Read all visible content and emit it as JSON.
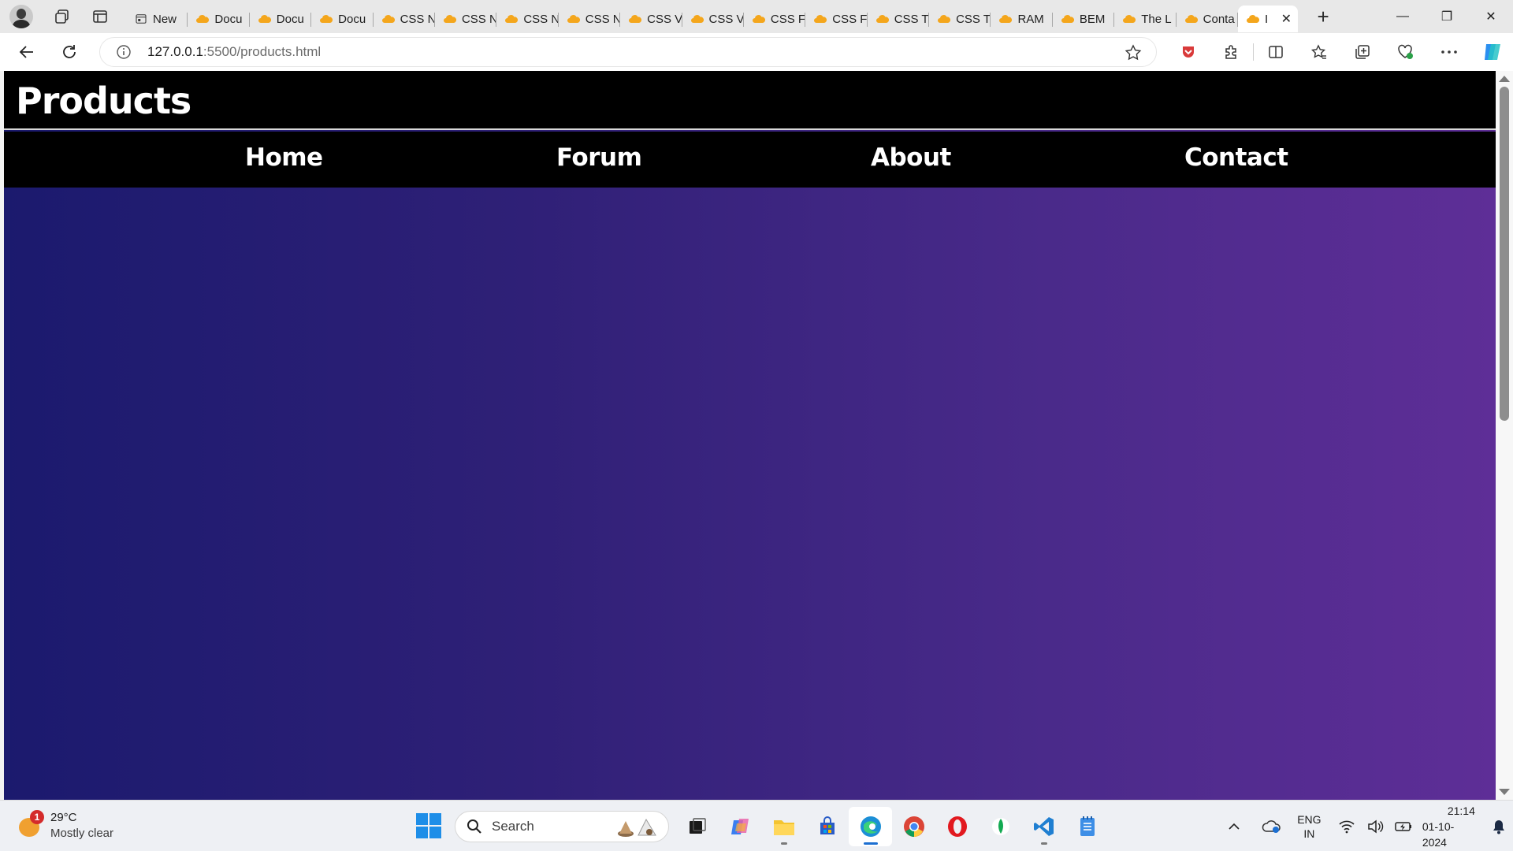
{
  "browser": {
    "tabs": [
      {
        "label": "New",
        "kind": "newtab"
      },
      {
        "label": "Docu",
        "kind": "cloud"
      },
      {
        "label": "Docu",
        "kind": "cloud"
      },
      {
        "label": "Docu",
        "kind": "cloud"
      },
      {
        "label": "CSS N",
        "kind": "cloud"
      },
      {
        "label": "CSS N",
        "kind": "cloud"
      },
      {
        "label": "CSS N",
        "kind": "cloud"
      },
      {
        "label": "CSS N",
        "kind": "cloud"
      },
      {
        "label": "CSS V",
        "kind": "cloud"
      },
      {
        "label": "CSS V",
        "kind": "cloud"
      },
      {
        "label": "CSS F",
        "kind": "cloud"
      },
      {
        "label": "CSS F",
        "kind": "cloud"
      },
      {
        "label": "CSS T",
        "kind": "cloud"
      },
      {
        "label": "CSS T",
        "kind": "cloud"
      },
      {
        "label": "RAM",
        "kind": "cloud"
      },
      {
        "label": "BEM",
        "kind": "cloud"
      },
      {
        "label": "The L",
        "kind": "cloud"
      },
      {
        "label": "Conta",
        "kind": "cloud"
      },
      {
        "label": "I",
        "kind": "cloud",
        "active": true
      }
    ],
    "url": {
      "host": "127.0.0.1",
      "rest": ":5500/products.html"
    },
    "window_controls": {
      "minimize": "—",
      "restore": "❐",
      "close": "✕"
    },
    "new_tab_symbol": "+"
  },
  "page": {
    "title": "Products",
    "nav": [
      "Home",
      "Forum",
      "About",
      "Contact"
    ],
    "gradient": {
      "from": "#1b1a6e",
      "to": "#5e2e97"
    }
  },
  "taskbar": {
    "weather": {
      "temp": "29°C",
      "desc": "Mostly clear",
      "badge": "1"
    },
    "search_label": "Search",
    "language": {
      "line1": "ENG",
      "line2": "IN"
    },
    "clock": {
      "time": "21:14",
      "date": "01-10-2024"
    }
  },
  "colors": {
    "header_bg": "#000000",
    "accent_windows": "#1e8ee8",
    "edge_blue": "#1c6fd1"
  }
}
